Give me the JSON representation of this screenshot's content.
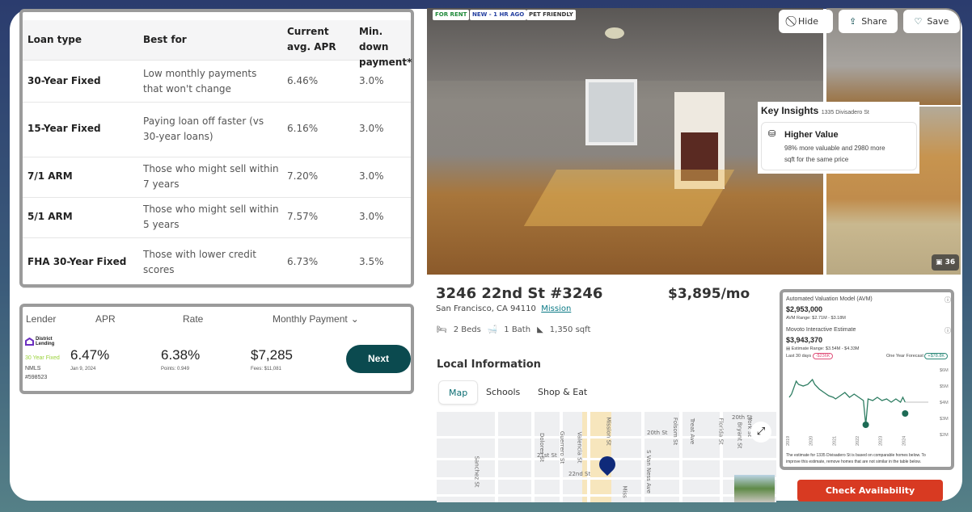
{
  "loan_table": {
    "headers": [
      "Loan type",
      "Best for",
      "Current avg. APR",
      "Min. down payment*"
    ],
    "header_lines": {
      "apr": [
        "Current",
        "avg. APR"
      ],
      "down": [
        "Min. down",
        "payment*"
      ]
    },
    "rows": [
      {
        "type": "30-Year Fixed",
        "best_for": [
          "Low monthly payments",
          "that won't change"
        ],
        "apr": "6.46%",
        "down": "3.0%"
      },
      {
        "type": "15-Year Fixed",
        "best_for": [
          "Paying loan off faster (vs",
          "30-year loans)"
        ],
        "apr": "6.16%",
        "down": "3.0%"
      },
      {
        "type": "7/1 ARM",
        "best_for": [
          "Those who might sell within",
          "7 years"
        ],
        "apr": "7.20%",
        "down": "3.0%"
      },
      {
        "type": "5/1 ARM",
        "best_for": [
          "Those who might sell within",
          "5 years"
        ],
        "apr": "7.57%",
        "down": "3.0%"
      },
      {
        "type": "FHA 30-Year Fixed",
        "best_for": [
          "Those with lower credit",
          "scores"
        ],
        "apr": "6.73%",
        "down": "3.5%"
      }
    ]
  },
  "lender_card": {
    "headers": {
      "lender": "Lender",
      "apr": "APR",
      "rate": "Rate",
      "monthly": "Monthly Payment"
    },
    "logo": [
      "District",
      "Lending"
    ],
    "product": "30 Year Fixed",
    "nmls": [
      "NMLS",
      "#598523"
    ],
    "apr": "6.47%",
    "apr_date": "Jan 9, 2024",
    "rate": "6.38%",
    "points": "Points: 0.949",
    "payment": "$7,285",
    "fees": "Fees: $11,081",
    "next_label": "Next"
  },
  "listing": {
    "tags": [
      "FOR RENT",
      "NEW - 1 HR AGO",
      "PET FRIENDLY"
    ],
    "actions": {
      "hide": "Hide",
      "share": "Share",
      "save": "Save"
    },
    "photo_count": "36",
    "key_insights": {
      "title": "Key Insights",
      "address": "1335 Divisadero St",
      "card_title": "Higher Value",
      "card_text": [
        "98% more valuable and 2980 more",
        "sqft for the same price"
      ]
    },
    "address": "3246 22nd St #3246",
    "city": "San Francisco, CA 94110",
    "neighborhood": "Mission",
    "price": "$3,895/mo",
    "beds": "2 Beds",
    "baths": "1 Bath",
    "sqft": "1,350 sqft",
    "local_info_title": "Local Information",
    "tabs": [
      "Map",
      "Schools",
      "Shop & Eat"
    ],
    "map_streets": [
      "Dolores St",
      "Guerrero St",
      "Valencia St",
      "Mission St",
      "S Van Ness Ave",
      "Folsom St",
      "Treat Ave",
      "Florida St",
      "Bryant St",
      "York St",
      "20th St",
      "20th St",
      "21st St",
      "22nd St",
      "Sanchez St",
      "Miss"
    ],
    "check_availability": "Check Availability",
    "colors": {
      "accent": "#0b4a4f",
      "cta": "#d83a22",
      "pin": "#0f2a7a",
      "chart_line": "#2e7d62"
    }
  },
  "avm": {
    "title": "Automated Valuation Model (AVM)",
    "value": "$2,953,000",
    "range": "AVM Range: $2.71M - $3.18M",
    "estimate_title": "Movoto Interactive Estimate",
    "estimate": "$3,943,370",
    "estimate_range": "Estimate Range: $3.54M - $4.33M",
    "last30_label": "Last 30 days",
    "last30_badge": "-$236K",
    "forecast_label": "One Year Forecast",
    "forecast_badge": "+$78.8K",
    "note": [
      "The estimate for 1335 Divisadero St is based on comparable homes below. To",
      "improve this estimate, remove homes that are not similar in the table below."
    ]
  },
  "chart_data": {
    "type": "line",
    "x_ticks": [
      "2019",
      "2020",
      "2021",
      "2022",
      "2023",
      "2024"
    ],
    "y_ticks": [
      "$2M",
      "$3M",
      "$4M",
      "$5M",
      "$6M"
    ],
    "ylim": [
      2,
      6
    ],
    "xlim": [
      2019,
      2025
    ],
    "series": [
      {
        "x": [
          2019,
          2019.1,
          2019.3,
          2019.4,
          2019.6,
          2019.8,
          2020,
          2020.1,
          2020.3,
          2020.5,
          2020.7,
          2020.9,
          2021,
          2021.2,
          2021.4,
          2021.6,
          2021.8,
          2022,
          2022.1,
          2022.2,
          2022.3,
          2022.4,
          2022.6,
          2022.8,
          2023,
          2023.2,
          2023.4,
          2023.6,
          2023.8,
          2023.9,
          2024
        ],
        "y": [
          4.3,
          4.5,
          5.3,
          5.1,
          5.0,
          5.1,
          5.4,
          5.1,
          4.8,
          4.6,
          4.4,
          4.3,
          4.2,
          4.4,
          4.6,
          4.3,
          4.5,
          4.3,
          4.2,
          4.1,
          2.6,
          4.2,
          4.1,
          4.3,
          4.1,
          4.2,
          4.0,
          4.2,
          4.0,
          4.3,
          4.0
        ]
      }
    ],
    "forecast": {
      "x": [
        2024,
        2025
      ],
      "y": [
        4.0,
        4.0
      ]
    },
    "markers": [
      {
        "x": 2022.3,
        "y": 2.6
      },
      {
        "x": 2024,
        "y": 3.3
      }
    ],
    "grid": false
  }
}
